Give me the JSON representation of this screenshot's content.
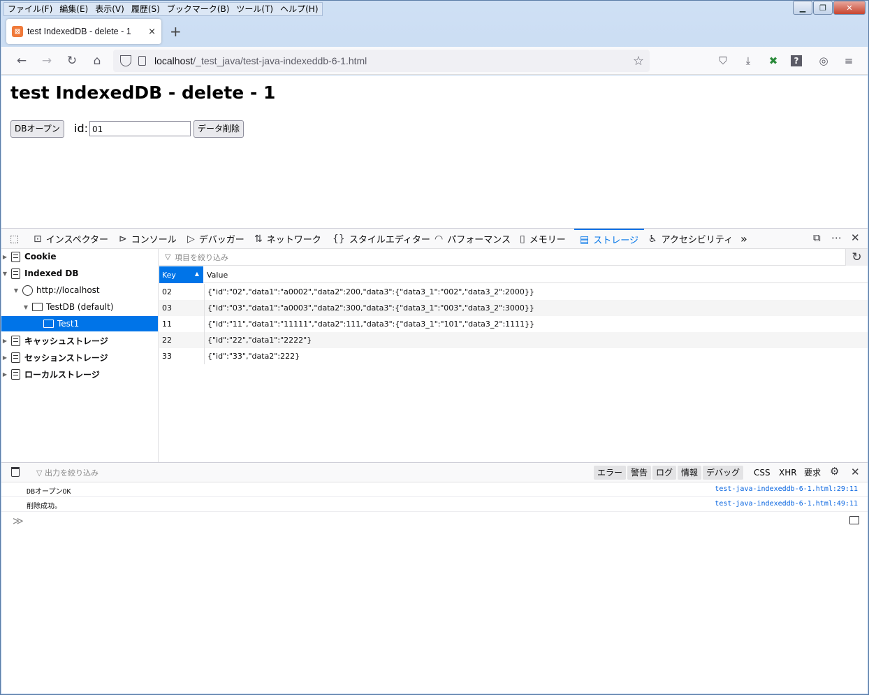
{
  "menubar": {
    "items": [
      "ファイル(F)",
      "編集(E)",
      "表示(V)",
      "履歴(S)",
      "ブックマーク(B)",
      "ツール(T)",
      "ヘルプ(H)"
    ]
  },
  "tab": {
    "title": "test IndexedDB - delete - 1",
    "close": "×"
  },
  "url": {
    "host": "localhost",
    "path": "/_test_java/test-java-indexeddb-6-1.html"
  },
  "page": {
    "heading": "test IndexedDB - delete - 1",
    "db_open_button": "DBオープン",
    "id_label": "id:",
    "id_value": "01",
    "delete_button": "データ削除"
  },
  "devtools": {
    "tabs": [
      "インスペクター",
      "コンソール",
      "デバッガー",
      "ネットワーク",
      "スタイルエディター",
      "パフォーマンス",
      "メモリー",
      "ストレージ",
      "アクセシビリティ"
    ],
    "active_tab": "ストレージ",
    "tree": {
      "cookie": "Cookie",
      "indexed_db": "Indexed DB",
      "origin": "http://localhost",
      "database": "TestDB (default)",
      "store": "Test1",
      "cache": "キャッシュストレージ",
      "session": "セッションストレージ",
      "local": "ローカルストレージ"
    },
    "filter_placeholder": "項目を絞り込み",
    "table": {
      "columns": [
        "Key",
        "Value"
      ],
      "rows": [
        {
          "key": "02",
          "value": "{\"id\":\"02\",\"data1\":\"a0002\",\"data2\":200,\"data3\":{\"data3_1\":\"002\",\"data3_2\":2000}}"
        },
        {
          "key": "03",
          "value": "{\"id\":\"03\",\"data1\":\"a0003\",\"data2\":300,\"data3\":{\"data3_1\":\"003\",\"data3_2\":3000}}"
        },
        {
          "key": "11",
          "value": "{\"id\":\"11\",\"data1\":\"11111\",\"data2\":111,\"data3\":{\"data3_1\":\"101\",\"data3_2\":1111}}"
        },
        {
          "key": "22",
          "value": "{\"id\":\"22\",\"data1\":\"2222\"}"
        },
        {
          "key": "33",
          "value": "{\"id\":\"33\",\"data2\":222}"
        }
      ]
    },
    "console": {
      "filter_placeholder": "出力を絞り込み",
      "levels": [
        "エラー",
        "警告",
        "ログ",
        "情報",
        "デバッグ"
      ],
      "extra": [
        "CSS",
        "XHR",
        "要求"
      ],
      "messages": [
        {
          "text": "DBオープンOK",
          "location": "test-java-indexeddb-6-1.html:29:11"
        },
        {
          "text": "削除成功。",
          "location": "test-java-indexeddb-6-1.html:49:11"
        }
      ],
      "prompt": "≫"
    }
  },
  "colors": {
    "accent": "#0074e8",
    "link": "#0060df"
  }
}
